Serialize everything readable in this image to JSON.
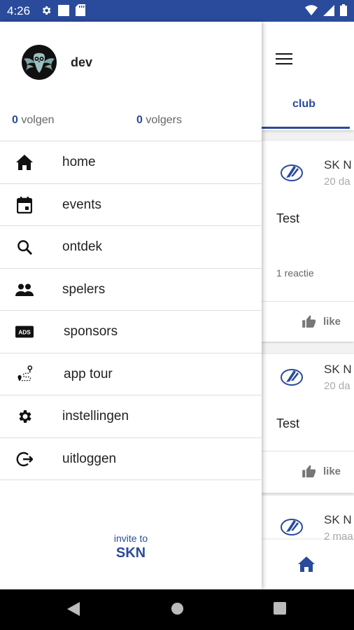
{
  "status_bar": {
    "time": "4:26"
  },
  "drawer": {
    "username": "dev",
    "following_count": "0",
    "following_label": "volgen",
    "followers_count": "0",
    "followers_label": "volgers",
    "menu": [
      {
        "label": "home",
        "icon": "home-icon"
      },
      {
        "label": "events",
        "icon": "calendar-icon"
      },
      {
        "label": "ontdek",
        "icon": "search-icon"
      },
      {
        "label": "spelers",
        "icon": "people-icon"
      },
      {
        "label": "sponsors",
        "icon": "ads-icon"
      },
      {
        "label": "app tour",
        "icon": "route-icon"
      },
      {
        "label": "instellingen",
        "icon": "gear-icon"
      },
      {
        "label": "uitloggen",
        "icon": "logout-icon"
      }
    ],
    "invite_line1": "invite to",
    "invite_line2": "SKN"
  },
  "background": {
    "tab": "club",
    "posts": [
      {
        "name": "SK N",
        "date": "20 da",
        "text": "Test",
        "reactions": "1 reactie",
        "like": "like"
      },
      {
        "name": "SK N",
        "date": "20 da",
        "text": "Test",
        "like": "like"
      },
      {
        "name": "SK N",
        "date": "2 maa"
      }
    ]
  },
  "colors": {
    "accent": "#2a4b9b",
    "statusbar": "#2a4b9b"
  }
}
